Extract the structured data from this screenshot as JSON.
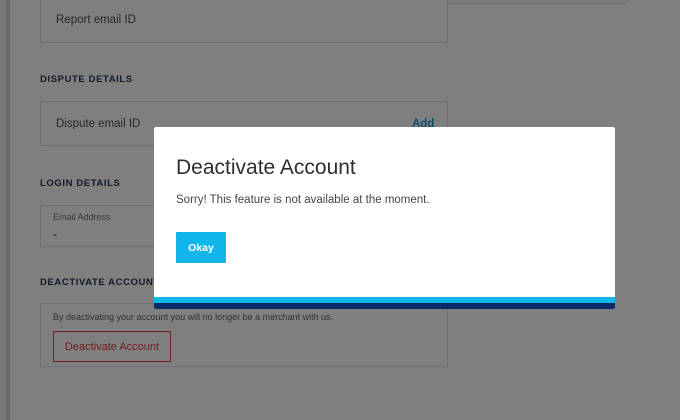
{
  "background": {
    "report": {
      "label": "Report email ID"
    },
    "dispute": {
      "section_title": "DISPUTE DETAILS",
      "label": "Dispute email ID",
      "add_label": "Add"
    },
    "login": {
      "section_title": "LOGIN DETAILS",
      "email_label": "Email Address",
      "email_value": "-"
    },
    "deactivate": {
      "section_title": "DEACTIVATE ACCOUNT",
      "description": "By deactivating your account you will no longer be a merchant with us.",
      "button_label": "Deactivate Account"
    }
  },
  "modal": {
    "title": "Deactivate Account",
    "message": "Sorry! This feature is not available at the moment.",
    "okay_label": "Okay"
  },
  "colors": {
    "accent": "#12b5ea",
    "accent_dark": "#0e2a66",
    "link": "#1c9bd7",
    "danger": "#e23b3b",
    "section_title": "#1f3555"
  }
}
